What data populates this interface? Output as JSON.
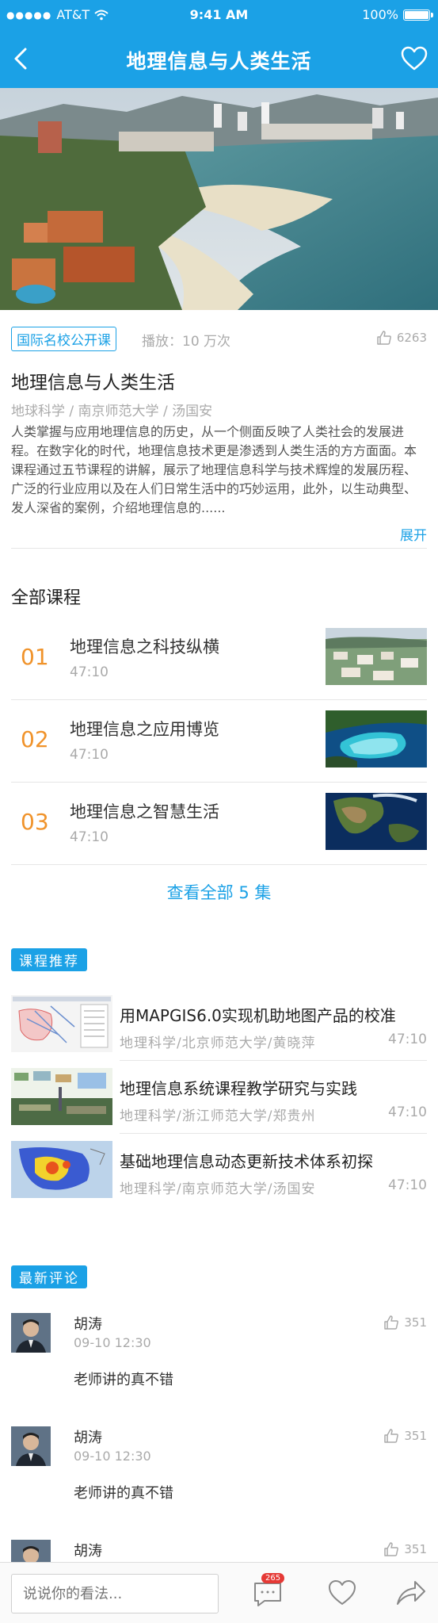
{
  "status_bar": {
    "carrier": "AT&T",
    "signal": "●●●●●",
    "time": "9:41 AM",
    "battery": "100%"
  },
  "nav": {
    "title": "地理信息与人类生活"
  },
  "course": {
    "tag": "国际名校公开课",
    "plays": "播放：10 万次",
    "likes": "6263",
    "title": "地理信息与人类生活",
    "subtitle": "地球科学 / 南京师范大学 / 汤国安",
    "description": "人类掌握与应用地理信息的历史，从一个侧面反映了人类社会的发展进程。在数字化的时代，地理信息技术更是渗透到人类生活的方方面面。本课程通过五节课程的讲解，展示了地理信息科学与技术辉煌的发展历程、广泛的行业应用以及在人们日常生活中的巧妙运用，此外，以生动典型、发人深省的案例，介绍地理信息的......",
    "expand_label": "展开"
  },
  "episodes_section": {
    "title": "全部课程",
    "items": [
      {
        "num": "01",
        "title": "地理信息之科技纵横",
        "duration": "47:10"
      },
      {
        "num": "02",
        "title": "地理信息之应用博览",
        "duration": "47:10"
      },
      {
        "num": "03",
        "title": "地理信息之智慧生活",
        "duration": "47:10"
      }
    ],
    "view_all": "查看全部 5 集"
  },
  "recommend": {
    "tag": "课程推荐",
    "items": [
      {
        "title": "用MAPGIS6.0实现机助地图产品的校准",
        "subtitle": "地理科学/北京师范大学/黄晓萍",
        "duration": "47:10"
      },
      {
        "title": "地理信息系统课程教学研究与实践",
        "subtitle": "地理科学/浙江师范大学/郑贵州",
        "duration": "47:10"
      },
      {
        "title": "基础地理信息动态更新技术体系初探",
        "subtitle": "地理科学/南京师范大学/汤国安",
        "duration": "47:10"
      }
    ]
  },
  "comments": {
    "tag": "最新评论",
    "items": [
      {
        "name": "胡涛",
        "time": "09-10 12:30",
        "text": "老师讲的真不错",
        "likes": "351"
      },
      {
        "name": "胡涛",
        "time": "09-10 12:30",
        "text": "老师讲的真不错",
        "likes": "351"
      },
      {
        "name": "胡涛",
        "time": "",
        "text": "",
        "likes": "351"
      }
    ]
  },
  "bottom_bar": {
    "placeholder": "说说你的看法...",
    "comment_count": "265"
  },
  "colors": {
    "primary": "#1ba1e6",
    "accent_orange": "#f0932b",
    "badge_red": "#e53935"
  }
}
